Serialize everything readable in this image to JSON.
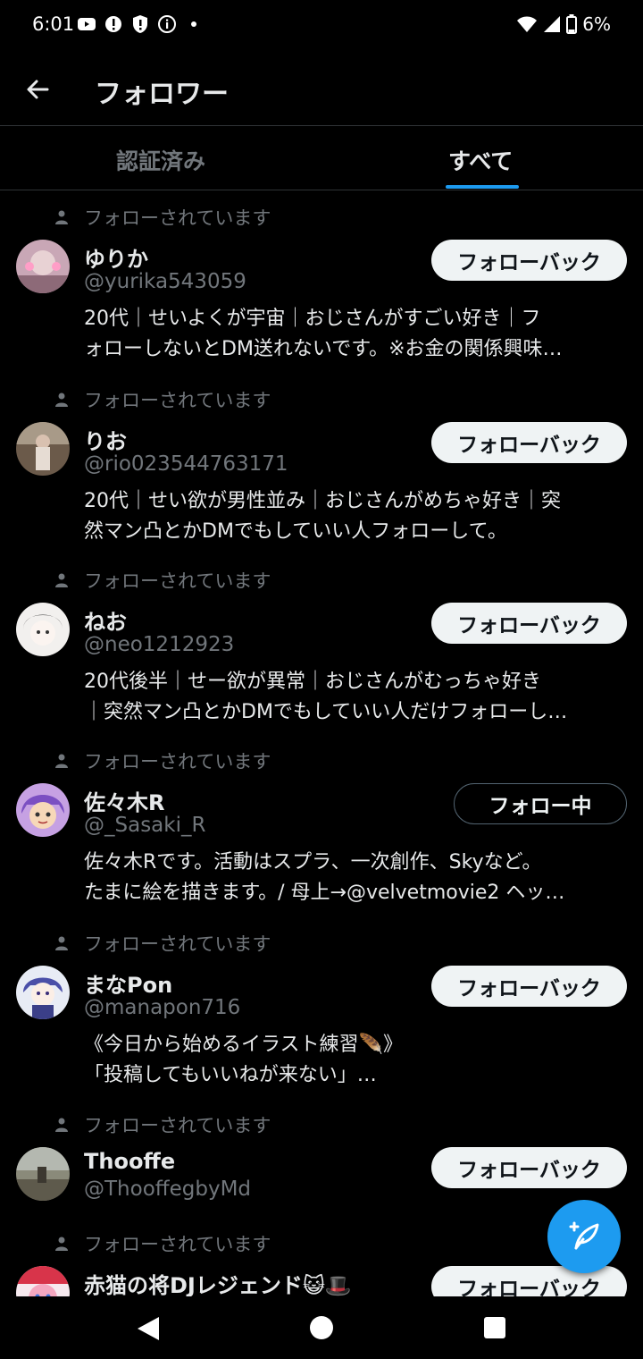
{
  "status_bar": {
    "time": "6:01",
    "battery": "6%",
    "icons": [
      "youtube-icon",
      "alert-icon",
      "shield-icon",
      "info-icon",
      "dot-icon",
      "wifi-icon",
      "signal-icon",
      "battery-icon"
    ]
  },
  "header": {
    "title": "フォロワー",
    "back_icon": "arrow-left-icon"
  },
  "tabs": [
    {
      "label": "認証済み",
      "selected": false
    },
    {
      "label": "すべて",
      "selected": true
    }
  ],
  "accent": "#1d9bf0",
  "followers": [
    {
      "follows_you": "フォローされています",
      "name": "ゆりか",
      "handle": "@yurika543059",
      "button": "フォローバック",
      "bio": [
        "20代｜せいよくが宇宙｜おじさんがすごい好き｜フ",
        "ォローしないとDM送れないです。※お金の関係興味…"
      ]
    },
    {
      "follows_you": "フォローされています",
      "name": "りお",
      "handle": "@rio023544763171",
      "button": "フォローバック",
      "bio": [
        "20代｜せい欲が男性並み｜おじさんがめちゃ好き｜突",
        "然マン凸とかDMでもしていい人フォローして。"
      ]
    },
    {
      "follows_you": "フォローされています",
      "name": "ねお",
      "handle": "@neo1212923",
      "button": "フォローバック",
      "bio": [
        "20代後半｜せー欲が異常｜おじさんがむっちゃ好き",
        "｜突然マン凸とかDMでもしていい人だけフォローし…"
      ]
    },
    {
      "follows_you": "フォローされています",
      "name": "佐々木R",
      "handle": "@_Sasaki_R",
      "button": "フォロー中",
      "bio": [
        "佐々木Rです。活動はスプラ、一次創作、Skyなど。",
        "たまに絵を描きます。/ 母上→@velvetmovie2 ヘッ…"
      ]
    },
    {
      "follows_you": "フォローされています",
      "name": "まなPon",
      "handle": "@manapon716",
      "button": "フォローバック",
      "bio": [
        "《今日から始めるイラスト練習🪶》",
        "「投稿してもいいねが来ない」…"
      ]
    },
    {
      "follows_you": "フォローされています",
      "name": "Thooffe",
      "handle": "@ThooffegbyMd",
      "button": "フォローバック",
      "bio": []
    },
    {
      "follows_you": "フォローされています",
      "name": "赤猫の将DJレジェンド😺🎩",
      "handle": "",
      "button": "フォローバック",
      "bio": []
    }
  ],
  "fab": {
    "icon": "compose-feather-plus-icon"
  },
  "nav_bar": {
    "icons": [
      "back-triangle-icon",
      "home-circle-icon",
      "recents-square-icon"
    ]
  }
}
